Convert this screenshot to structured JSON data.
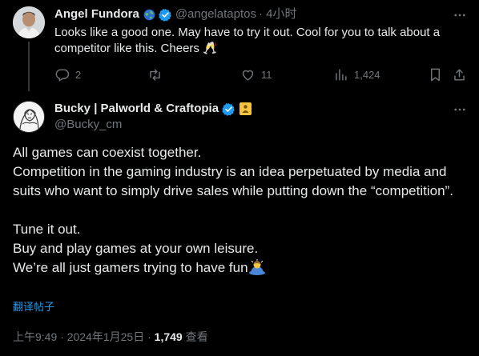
{
  "reply": {
    "author_name": "Angel Fundora",
    "handle": "@angelataptos",
    "time": "· 4小时",
    "text": "Looks like a good one.  May have to try it out.  Cool for you to talk about a competitor like this.  Cheers 🥂",
    "reply_count": "2",
    "retweet_count": "",
    "like_count": "11",
    "view_count": "1,424",
    "more_icon": "more-horizontal-icon"
  },
  "tweet": {
    "author_name": "Bucky | Palworld & Craftopia",
    "handle": "@Bucky_cm",
    "lines": [
      "All games can coexist together.",
      "Competition in the gaming industry is an idea perpetuated by media and suits who want to simply drive sales while putting down the “competition”.",
      "",
      "Tune it out.",
      "Buy and play games at your own leisure.",
      "We’re all just gamers trying to have fun"
    ],
    "translate_label": "翻译帖子",
    "time": "上午9:49",
    "date": "2024年1月25日",
    "views": "1,749",
    "views_label": "查看",
    "separator": "·"
  },
  "colors": {
    "background": "#000000",
    "text": "#e7e9ea",
    "muted": "#71767b",
    "accent": "#1d9bf0",
    "divider": "#333639"
  }
}
